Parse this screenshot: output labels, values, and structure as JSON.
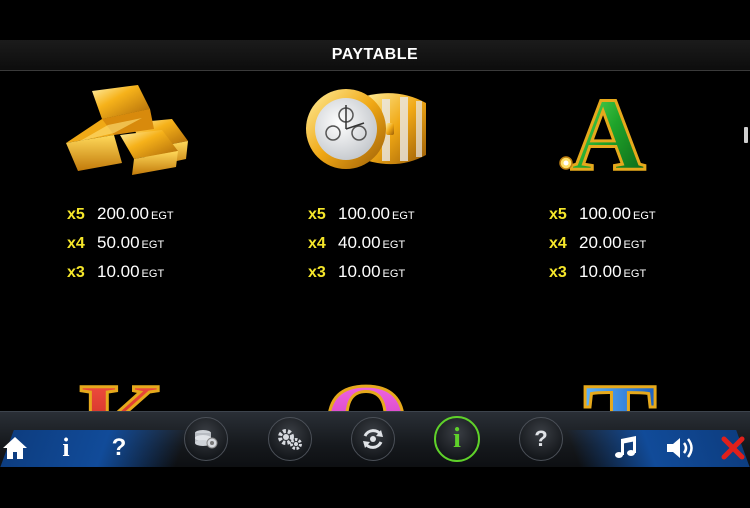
{
  "header": {
    "title": "PAYTABLE"
  },
  "paytable": [
    {
      "symbol": "gold-bars-icon",
      "pays": [
        {
          "mult": "x5",
          "amount": "200.00",
          "currency": "EGT"
        },
        {
          "mult": "x4",
          "amount": "50.00",
          "currency": "EGT"
        },
        {
          "mult": "x3",
          "amount": "10.00",
          "currency": "EGT"
        }
      ]
    },
    {
      "symbol": "gold-watch-icon",
      "pays": [
        {
          "mult": "x5",
          "amount": "100.00",
          "currency": "EGT"
        },
        {
          "mult": "x4",
          "amount": "40.00",
          "currency": "EGT"
        },
        {
          "mult": "x3",
          "amount": "10.00",
          "currency": "EGT"
        }
      ]
    },
    {
      "symbol": "letter-a-icon",
      "pays": [
        {
          "mult": "x5",
          "amount": "100.00",
          "currency": "EGT"
        },
        {
          "mult": "x4",
          "amount": "20.00",
          "currency": "EGT"
        },
        {
          "mult": "x3",
          "amount": "10.00",
          "currency": "EGT"
        }
      ]
    }
  ],
  "symbol_letters": {
    "a": "A",
    "k": "K",
    "q": "Q",
    "t": "T"
  },
  "toolbar": {
    "info_label": "i",
    "help_label": "?",
    "info_active_label": "i",
    "help_circle_label": "?"
  },
  "colors": {
    "multiplier": "#f5e62a",
    "active_ring": "#5fd12a",
    "close": "#e0201b",
    "glow": "#114b99"
  }
}
